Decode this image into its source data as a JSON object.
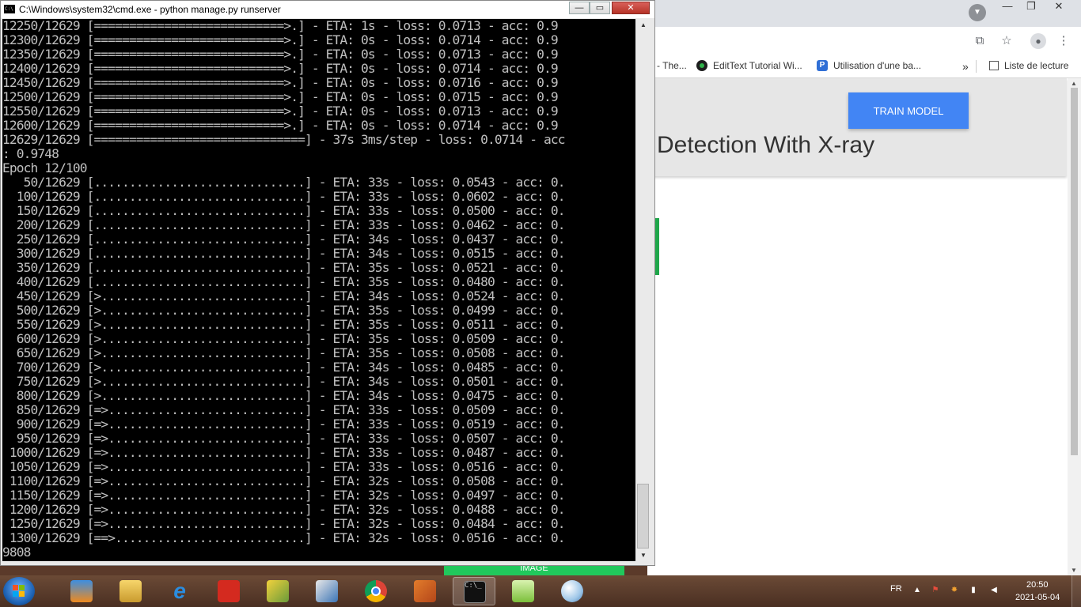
{
  "cmd": {
    "title": "C:\\Windows\\system32\\cmd.exe - python  manage.py runserver",
    "icon": "cmd-icon",
    "controls": {
      "minimize": "—",
      "maximize": "▭",
      "close": "✕"
    },
    "lines": [
      "12250/12629 [===========================>.] - ETA: 1s - loss: 0.0713 - acc: 0.9",
      "12300/12629 [===========================>.] - ETA: 0s - loss: 0.0714 - acc: 0.9",
      "12350/12629 [===========================>.] - ETA: 0s - loss: 0.0713 - acc: 0.9",
      "12400/12629 [===========================>.] - ETA: 0s - loss: 0.0714 - acc: 0.9",
      "12450/12629 [===========================>.] - ETA: 0s - loss: 0.0716 - acc: 0.9",
      "12500/12629 [===========================>.] - ETA: 0s - loss: 0.0715 - acc: 0.9",
      "12550/12629 [===========================>.] - ETA: 0s - loss: 0.0713 - acc: 0.9",
      "12600/12629 [===========================>.] - ETA: 0s - loss: 0.0714 - acc: 0.9",
      "12629/12629 [==============================] - 37s 3ms/step - loss: 0.0714 - acc",
      ": 0.9748",
      "Epoch 12/100",
      "   50/12629 [..............................] - ETA: 33s - loss: 0.0543 - acc: 0.",
      "  100/12629 [..............................] - ETA: 33s - loss: 0.0602 - acc: 0.",
      "  150/12629 [..............................] - ETA: 33s - loss: 0.0500 - acc: 0.",
      "  200/12629 [..............................] - ETA: 33s - loss: 0.0462 - acc: 0.",
      "  250/12629 [..............................] - ETA: 34s - loss: 0.0437 - acc: 0.",
      "  300/12629 [..............................] - ETA: 34s - loss: 0.0515 - acc: 0.",
      "  350/12629 [..............................] - ETA: 35s - loss: 0.0521 - acc: 0.",
      "  400/12629 [..............................] - ETA: 35s - loss: 0.0480 - acc: 0.",
      "  450/12629 [>.............................] - ETA: 34s - loss: 0.0524 - acc: 0.",
      "  500/12629 [>.............................] - ETA: 35s - loss: 0.0499 - acc: 0.",
      "  550/12629 [>.............................] - ETA: 35s - loss: 0.0511 - acc: 0.",
      "  600/12629 [>.............................] - ETA: 35s - loss: 0.0509 - acc: 0.",
      "  650/12629 [>.............................] - ETA: 35s - loss: 0.0508 - acc: 0.",
      "  700/12629 [>.............................] - ETA: 34s - loss: 0.0485 - acc: 0.",
      "  750/12629 [>.............................] - ETA: 34s - loss: 0.0501 - acc: 0.",
      "  800/12629 [>.............................] - ETA: 34s - loss: 0.0475 - acc: 0.",
      "  850/12629 [=>............................] - ETA: 33s - loss: 0.0509 - acc: 0.",
      "  900/12629 [=>............................] - ETA: 33s - loss: 0.0519 - acc: 0.",
      "  950/12629 [=>............................] - ETA: 33s - loss: 0.0507 - acc: 0.",
      " 1000/12629 [=>............................] - ETA: 33s - loss: 0.0487 - acc: 0.",
      " 1050/12629 [=>............................] - ETA: 33s - loss: 0.0516 - acc: 0.",
      " 1100/12629 [=>............................] - ETA: 32s - loss: 0.0508 - acc: 0.",
      " 1150/12629 [=>............................] - ETA: 32s - loss: 0.0497 - acc: 0.",
      " 1200/12629 [=>............................] - ETA: 32s - loss: 0.0488 - acc: 0.",
      " 1250/12629 [=>............................] - ETA: 32s - loss: 0.0484 - acc: 0.",
      " 1300/12629 [==>...........................] - ETA: 32s - loss: 0.0516 - acc: 0.",
      "9808"
    ]
  },
  "browser": {
    "bookmarks": [
      {
        "label": "- The...",
        "icon": ""
      },
      {
        "label": "EditText Tutorial Wi...",
        "icon": "edittext-favicon"
      },
      {
        "label": "Utilisation d'une ba...",
        "icon": "bookmark-favicon"
      }
    ],
    "more_bookmarks": "»",
    "reading_list": "Liste de lecture",
    "train_button": "TRAIN MODEL",
    "page_title": "Detection With X-ray",
    "upload_button": "IMAGE"
  },
  "taskbar": {
    "items": [
      "start-button",
      "media-player",
      "file-explorer",
      "internet-explorer",
      "acrobat-reader",
      "python-idle",
      "python-launcher",
      "chrome",
      "matlab",
      "command-prompt",
      "notepad-plus-plus",
      "paint"
    ],
    "language": "FR",
    "time": "20:50",
    "date": "2021-05-04"
  }
}
